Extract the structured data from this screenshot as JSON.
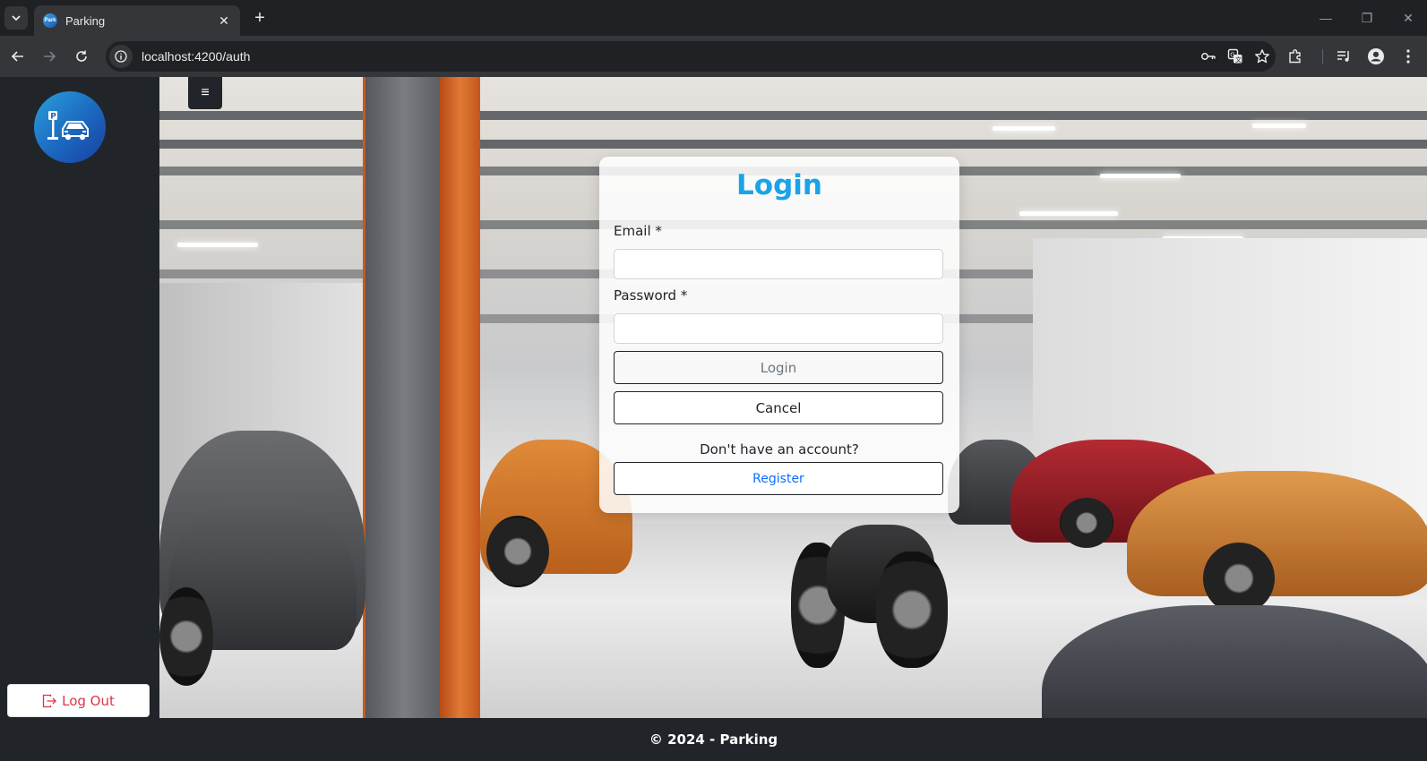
{
  "browser": {
    "tab_title": "Parking",
    "favicon_text": "Park",
    "url": "localhost:4200/auth"
  },
  "sidebar": {
    "logout_label": "Log Out"
  },
  "login": {
    "title": "Login",
    "email_label": "Email *",
    "email_value": "",
    "password_label": "Password *",
    "password_value": "",
    "login_button": "Login",
    "cancel_button": "Cancel",
    "account_prompt": "Don't have an account?",
    "register_button": "Register"
  },
  "footer": {
    "text": "© 2024 - Parking"
  },
  "colors": {
    "title_accent": "#1aa3e8",
    "logout_red": "#dc3545",
    "register_blue": "#0d6efd",
    "sidebar_bg": "#212529"
  },
  "icons": [
    "tab-dropdown-icon",
    "favicon-icon",
    "close-icon",
    "plus-icon",
    "minimize-icon",
    "restore-icon",
    "window-close-icon",
    "back-icon",
    "forward-icon",
    "reload-icon",
    "site-info-icon",
    "key-icon",
    "translate-icon",
    "star-icon",
    "extensions-icon",
    "media-icon",
    "profile-icon",
    "kebab-menu-icon",
    "parking-logo-icon",
    "hamburger-icon",
    "logout-icon"
  ]
}
